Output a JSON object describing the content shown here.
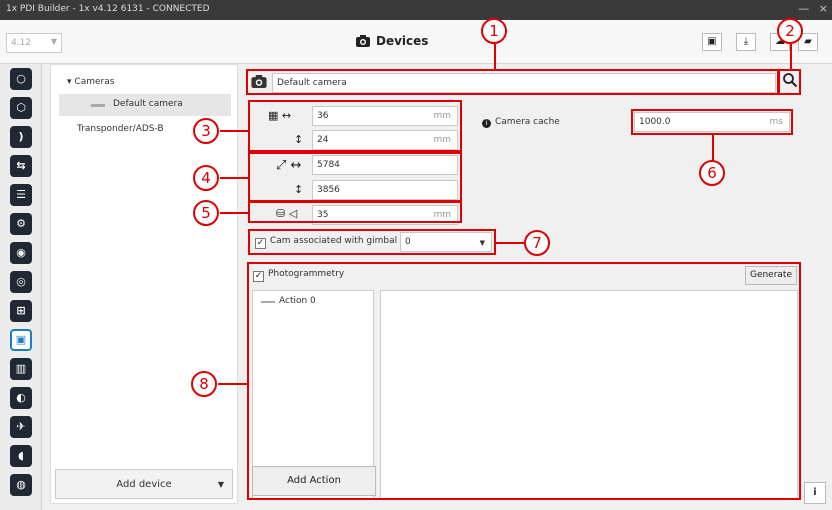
{
  "window": {
    "title": "1x PDI Builder - 1x v4.12 6131 - CONNECTED",
    "minimize": "—",
    "close": "×"
  },
  "toolbar": {
    "version_selected": "4.12",
    "title": "Devices",
    "button_icons": [
      "save-icon",
      "download-icon",
      "upload-icon",
      "folder-open-icon"
    ]
  },
  "tree": {
    "cameras_label": "Cameras",
    "default_camera": "Default camera",
    "transponder": "Transponder/ADS-B",
    "add_device": "Add device"
  },
  "camera": {
    "name_value": "Default camera",
    "sensor_width": "36",
    "sensor_height": "24",
    "sensor_unit": "mm",
    "res_width": "5784",
    "res_height": "3856",
    "focal_length": "35",
    "focal_unit": "mm",
    "cache_label": "Camera cache",
    "cache_value": "1000.0",
    "cache_unit": "ms",
    "gimbal_label": "Cam associated with gimbal",
    "gimbal_value": "0"
  },
  "photogrammetry": {
    "label": "Photogrammetry",
    "generate": "Generate",
    "actions": [
      "Action 0"
    ],
    "add_action": "Add Action"
  },
  "callouts": [
    "1",
    "2",
    "3",
    "4",
    "5",
    "6",
    "7",
    "8"
  ],
  "colors": {
    "annotation": "#e00000",
    "accent": "#1c7fc4",
    "icon_bg": "#1f2833"
  }
}
